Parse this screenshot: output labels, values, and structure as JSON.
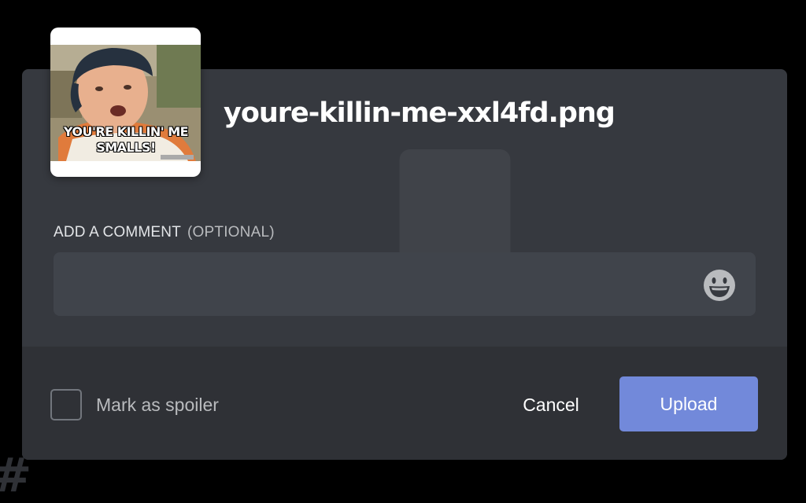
{
  "file": {
    "name": "youre-killin-me-xxl4fd.png",
    "meme_caption_line1": "YOU'RE KILLIN' ME",
    "meme_caption_line2": "SMALLS!"
  },
  "comment": {
    "label": "ADD A COMMENT",
    "optional": "(OPTIONAL)",
    "value": "",
    "emoji_icon": "smiling-face-icon"
  },
  "footer": {
    "spoiler_label": "Mark as spoiler",
    "spoiler_checked": false,
    "cancel_label": "Cancel",
    "upload_label": "Upload"
  },
  "colors": {
    "modal_bg": "#36393f",
    "footer_bg": "#2f3136",
    "input_bg": "#40444b",
    "accent": "#7289da",
    "muted_text": "#b9bbbe"
  }
}
